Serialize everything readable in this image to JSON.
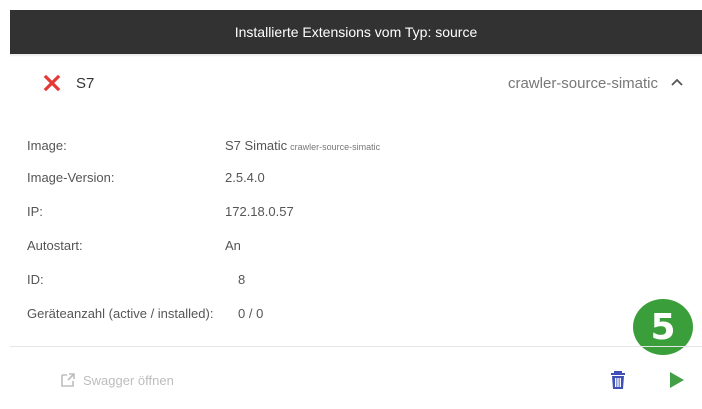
{
  "header": {
    "title": "Installierte Extensions vom Typ: source"
  },
  "extension": {
    "name": "S7",
    "image_name": "crawler-source-simatic",
    "status_icon": "close-icon",
    "expand_icon": "chevron-up-icon"
  },
  "details": {
    "image_label": "Image:",
    "image_value": "S7 Simatic",
    "image_subvalue": "crawler-source-simatic",
    "version_label": "Image-Version:",
    "version_value": "2.5.4.0",
    "ip_label": "IP:",
    "ip_value": "172.18.0.57",
    "autostart_label": "Autostart:",
    "autostart_value": "An",
    "id_label": "ID:",
    "id_value": "8",
    "devices_label": "Geräteanzahl (active / installed):",
    "devices_value": "0 / 0"
  },
  "badge": {
    "number": "5",
    "color": "#3a9f3a"
  },
  "footer": {
    "swagger_label": "Swagger öffnen",
    "swagger_icon": "open-external-icon",
    "delete_icon": "trash-icon",
    "start_icon": "play-icon"
  },
  "colors": {
    "header_bg": "#323232",
    "close_red": "#e53935",
    "trash_blue": "#3f51b5",
    "play_green": "#43a047",
    "disabled_gray": "#bdbdbd"
  }
}
